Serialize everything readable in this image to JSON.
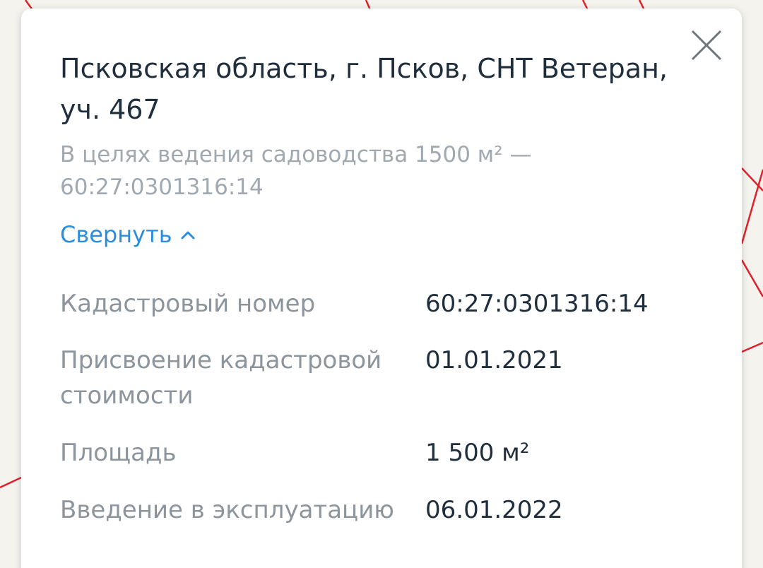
{
  "map": {
    "boundary_color": "#e0202a"
  },
  "card": {
    "title": "Псковская область, г. Псков, СНТ Ветеран, уч. 467",
    "subtitle": "В целях ведения садоводства 1500 м² — 60:27:0301316:14",
    "collapse_label": "Свернуть",
    "close_icon": "close-icon",
    "link_color": "#2a8de0"
  },
  "details": [
    {
      "label": "Кадастровый номер",
      "value": "60:27:0301316:14"
    },
    {
      "label": "Присвоение кадастровой стоимости",
      "value": "01.01.2021"
    },
    {
      "label": "Площадь",
      "value": "1 500 м²"
    },
    {
      "label": "Введение в эксплуатацию",
      "value": "06.01.2022"
    }
  ]
}
